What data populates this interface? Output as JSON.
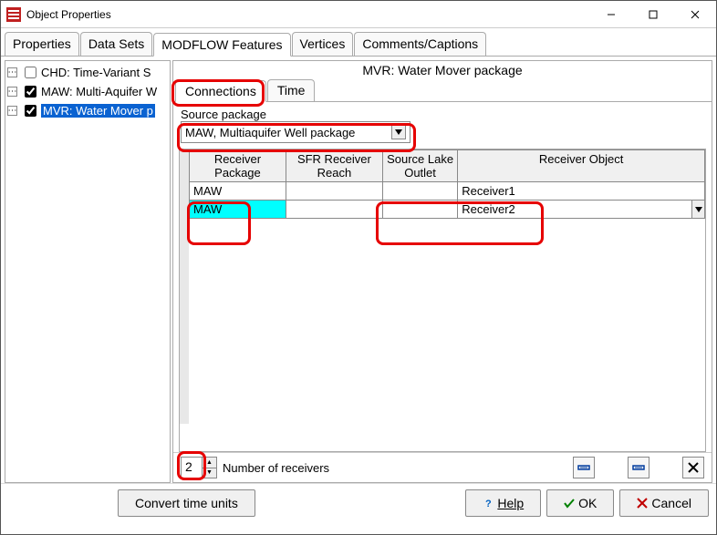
{
  "window": {
    "title": "Object Properties"
  },
  "tabs": [
    "Properties",
    "Data Sets",
    "MODFLOW Features",
    "Vertices",
    "Comments/Captions"
  ],
  "active_tab": 2,
  "tree": {
    "items": [
      {
        "label": "CHD: Time-Variant S",
        "checked": false,
        "selected": false
      },
      {
        "label": "MAW: Multi-Aquifer W",
        "checked": true,
        "selected": false
      },
      {
        "label": "MVR: Water Mover p",
        "checked": true,
        "selected": true
      }
    ]
  },
  "panel": {
    "title": "MVR: Water Mover package",
    "sub_tabs": [
      "Connections",
      "Time"
    ],
    "active_sub_tab": 0,
    "source_package_label": "Source package",
    "source_package_value": "MAW, Multiaquifer Well package",
    "table": {
      "headers": [
        "Receiver Package",
        "SFR Receiver Reach",
        "Source Lake Outlet",
        "Receiver Object"
      ],
      "rows": [
        {
          "pkg": "MAW",
          "sfr": "",
          "lake": "",
          "obj": "Receiver1",
          "sel": false
        },
        {
          "pkg": "MAW",
          "sfr": "",
          "lake": "",
          "obj": "Receiver2",
          "sel": true
        }
      ]
    },
    "receivers_count": "2",
    "receivers_label": "Number of receivers"
  },
  "footer": {
    "convert": "Convert time units",
    "help": "Help",
    "ok": "OK",
    "cancel": "Cancel"
  }
}
